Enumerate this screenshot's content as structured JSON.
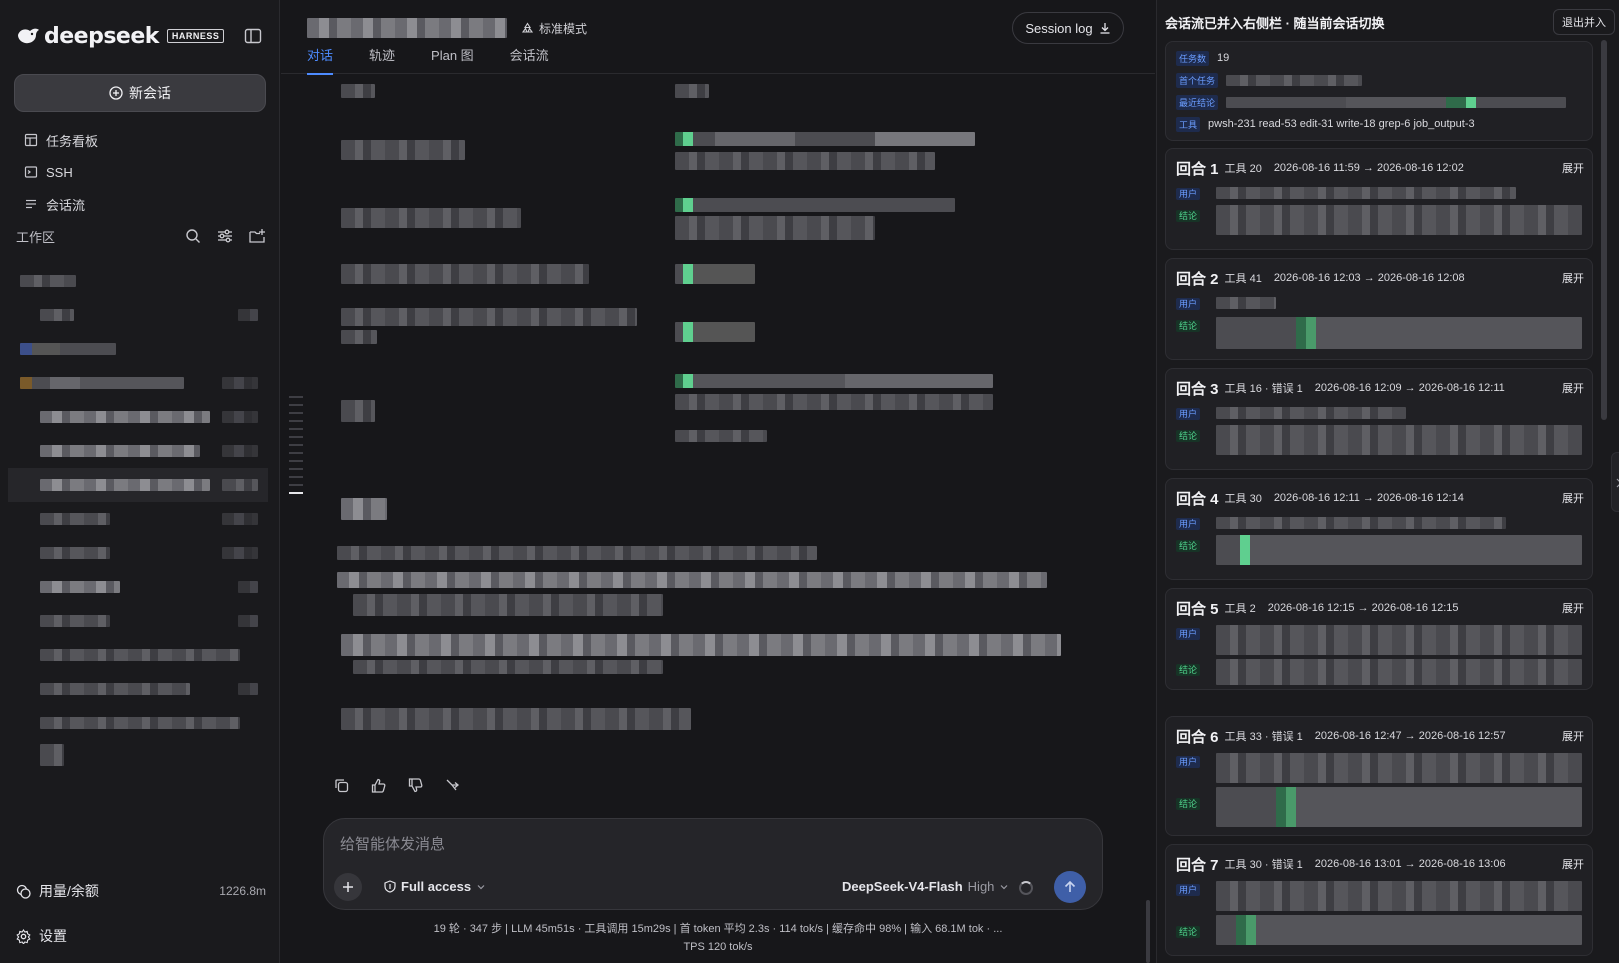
{
  "sidebar": {
    "brand": "deepseek",
    "brand_badge": "HARNESS",
    "new_chat": "新会话",
    "nav": [
      {
        "label": "任务看板",
        "icon": "kanban-icon"
      },
      {
        "label": "SSH",
        "icon": "terminal-icon"
      },
      {
        "label": "会话流",
        "icon": "list-icon"
      }
    ],
    "workspace_title": "工作区",
    "usage_label": "用量/余额",
    "usage_value": "1226.8m",
    "settings_label": "设置"
  },
  "header": {
    "mode_label": "标准模式",
    "session_log": "Session log",
    "tabs": [
      "对话",
      "轨迹",
      "Plan 图",
      "会话流"
    ],
    "active_tab": "对话"
  },
  "composer": {
    "placeholder": "给智能体发消息",
    "access": "Full access",
    "model": "DeepSeek-V4-Flash",
    "level": "High"
  },
  "stats": {
    "line1": "19 轮 · 347 步  |  LLM 45m51s · 工具调用 15m29s  |  首 token 平均 2.3s · 114 tok/s  |  缓存命中 98%  |  输入 68.1M tok · ...",
    "line2": "TPS 120 tok/s"
  },
  "right_panel": {
    "title": "会话流已并入右侧栏 · 随当前会话切换",
    "exit": "退出并入",
    "summary": {
      "task_count_tag": "任务数",
      "task_count": "19",
      "first_task_tag": "首个任务",
      "last_conclusion_tag": "最近结论",
      "tools_tag": "工具",
      "tools": "pwsh-231 read-53 edit-31 write-18 grep-6 job_output-3"
    },
    "user_tag": "用户",
    "conclusion_tag": "结论",
    "expand": "展开",
    "rounds": [
      {
        "title": "回合 1",
        "meta": "工具 20",
        "time": "2026-08-16 11:59 → 2026-08-16 12:02"
      },
      {
        "title": "回合 2",
        "meta": "工具 41",
        "time": "2026-08-16 12:03 → 2026-08-16 12:08"
      },
      {
        "title": "回合 3",
        "meta": "工具 16 · 错误 1",
        "time": "2026-08-16 12:09 → 2026-08-16 12:11"
      },
      {
        "title": "回合 4",
        "meta": "工具 30",
        "time": "2026-08-16 12:11 → 2026-08-16 12:14"
      },
      {
        "title": "回合 5",
        "meta": "工具 2",
        "time": "2026-08-16 12:15 → 2026-08-16 12:15"
      },
      {
        "title": "回合 6",
        "meta": "工具 33 · 错误 1",
        "time": "2026-08-16 12:47 → 2026-08-16 12:57"
      },
      {
        "title": "回合 7",
        "meta": "工具 30 · 错误 1",
        "time": "2026-08-16 13:01 → 2026-08-16 13:06"
      }
    ]
  }
}
